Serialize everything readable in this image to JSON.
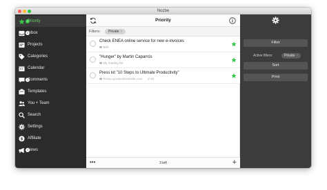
{
  "window": {
    "title": "Nozbe"
  },
  "sidebar": {
    "items": [
      {
        "label": "Priority",
        "icon": "star-icon",
        "badge": "3",
        "active": true
      },
      {
        "label": "Inbox",
        "icon": "inbox-icon",
        "badge": "3"
      },
      {
        "label": "Projects",
        "icon": "projects-icon"
      },
      {
        "label": "Categories",
        "icon": "tag-icon"
      },
      {
        "label": "Calendar",
        "icon": "calendar-icon"
      },
      {
        "label": "Comments",
        "icon": "comment-icon",
        "badge": "3"
      },
      {
        "label": "Templates",
        "icon": "templates-icon"
      },
      {
        "label": "You + Team",
        "icon": "team-icon"
      },
      {
        "label": "Search",
        "icon": "search-icon"
      },
      {
        "label": "Settings",
        "icon": "gear-icon"
      },
      {
        "label": "Affiliate",
        "icon": "affiliate-icon"
      },
      {
        "label": "News",
        "icon": "megaphone-icon",
        "badge": "3"
      }
    ]
  },
  "main": {
    "title": "Priority",
    "filters_label": "Filters:",
    "filter_chip": "Private",
    "tasks": [
      {
        "title": "Check ENEA online service for new e-invoices",
        "project": "Bills",
        "attachment": ""
      },
      {
        "title": "\"Hunger\" by Martin Caparrós",
        "project": "My reading list",
        "attachment": ""
      },
      {
        "title": "Press kit \"10 Steps to Ultimate Productivity\"",
        "project": "Promo.productiveinside.com",
        "attachment": "52"
      }
    ],
    "footer": {
      "more": "•••",
      "left_count": "3 left",
      "add": "+"
    }
  },
  "right_panel": {
    "filter_button": "Filter",
    "active_filters_label": "Active filters:",
    "active_filter_chip": "Private",
    "sort_button": "Sort",
    "print_button": "Print"
  },
  "colors": {
    "accent_green": "#38c84a",
    "sidebar_bg": "#2b2b2b",
    "right_panel_bg": "#3c3c3c"
  }
}
